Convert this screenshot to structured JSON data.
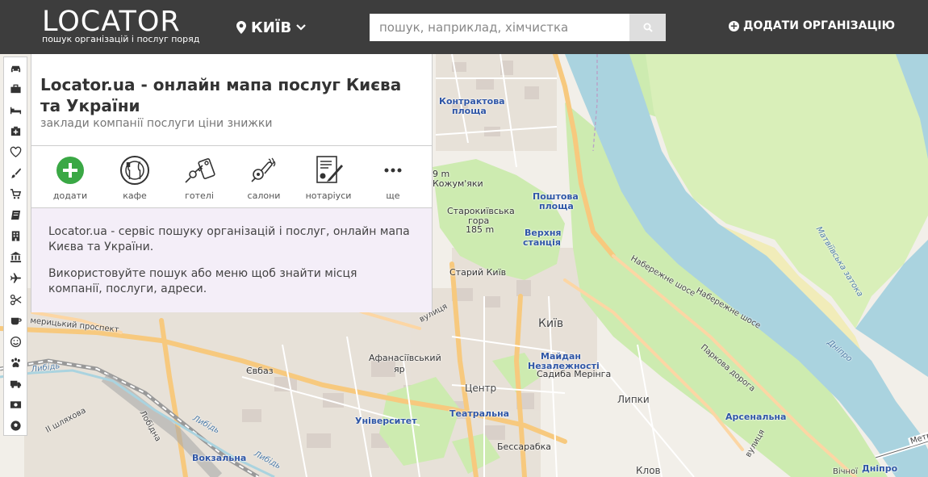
{
  "header": {
    "logo_text": "LOCATOR",
    "logo_tagline": "пошук організацій і послуг поряд",
    "city": "КИЇВ",
    "search_placeholder": "пошук, наприклад, хімчистка",
    "add_org_label": "ДОДАТИ ОРГАНІЗАЦІЮ"
  },
  "rail": {
    "icons": [
      "car-icon",
      "briefcase-icon",
      "bed-icon",
      "medkit-icon",
      "heart-icon",
      "brush-icon",
      "cart-icon",
      "book-icon",
      "building-icon",
      "bank-icon",
      "plane-icon",
      "scissors-icon",
      "coffee-icon",
      "smile-icon",
      "paw-icon",
      "truck-icon",
      "money-icon",
      "soccer-ball-icon"
    ]
  },
  "panel": {
    "title": "Locator.ua - онлайн мапа послуг Києва та України",
    "subtitle": "заклади компанії послуги ціни знижки",
    "categories": [
      {
        "label": "додати",
        "icon": "plus-circle-icon"
      },
      {
        "label": "кафе",
        "icon": "cutlery-icon"
      },
      {
        "label": "готелі",
        "icon": "key-icon"
      },
      {
        "label": "салони",
        "icon": "hair-dryer-icon"
      },
      {
        "label": "нотаріуси",
        "icon": "document-pen-icon"
      },
      {
        "label": "ще",
        "icon": "more-icon"
      }
    ],
    "description": [
      "Locator.ua - сервіс пошуку організацій і послуг, онлайн мапа Києва та України.",
      "Використовуйте пошук або меню щоб знайти місця компанії, послуги, адреси."
    ]
  },
  "map": {
    "labels": {
      "kontraktova_1": "Контрактова",
      "kontraktova_2": "площа",
      "poshtova_1": "Поштова",
      "poshtova_2": "площа",
      "verkhnya_1": "Верхня",
      "verkhnya_2": "станція",
      "starokyivska_1": "Старокиївська",
      "starokyivska_2": "гора",
      "starokyivska_3": "185 m",
      "kozhumyaky": "Кожум'яки",
      "staryi_kyiv": "Старий Київ",
      "kyiv": "Київ",
      "maidan_1": "Майдан",
      "maidan_2": "Незалежності",
      "sadyba": "Садиба Мерінга",
      "afanasiivskyi_1": "Афанасіївський",
      "afanasiivskyi_2": "яр",
      "tsentr": "Центр",
      "teatralna": "Театральна",
      "universytet": "Університет",
      "bessarabka": "Бессарабка",
      "vokzalna": "Вокзальна",
      "yevbaz": "Євбаз",
      "lypky": "Липки",
      "klov": "Клов",
      "arsenalna": "Арсенальна",
      "dnipro_station": "Дніпро",
      "naberezhne_1": "Набережне шосе",
      "naberezhne_2": "Набережне шосе",
      "parkova": "Паркова дорога",
      "dnipro_river": "Дніпро",
      "matukhivska": "Матвіївська затока",
      "prospekt": "мерицький проспект",
      "vulytsia": "вулиця",
      "lybid_1": "Либідь",
      "lybid_2": "Либідь",
      "lybid_3": "Либідь",
      "ii_sliach": "ІІ шляхова",
      "lobidna": "Лобідна",
      "metro_label": "Метр",
      "vichni": "Вічної",
      "ulitsa2": "вулиця",
      "m9": "9 m"
    }
  }
}
